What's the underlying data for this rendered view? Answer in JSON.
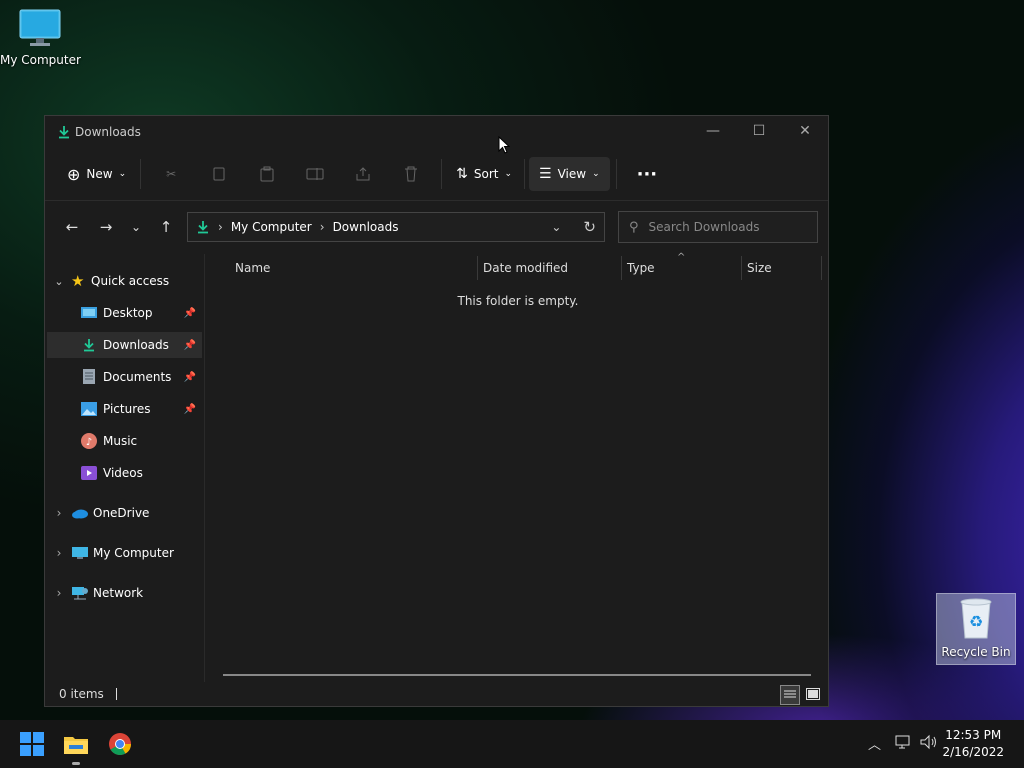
{
  "desktop": {
    "my_computer_label": "My Computer",
    "recycle_bin_label": "Recycle Bin"
  },
  "window": {
    "title": "Downloads",
    "toolbar": {
      "new_label": "New",
      "sort_label": "Sort",
      "view_label": "View"
    },
    "address": {
      "segments": [
        "My Computer",
        "Downloads"
      ]
    },
    "search": {
      "placeholder": "Search Downloads"
    },
    "nav": {
      "quick_access": "Quick access",
      "items": [
        {
          "label": "Desktop",
          "pinned": true
        },
        {
          "label": "Downloads",
          "pinned": true,
          "selected": true
        },
        {
          "label": "Documents",
          "pinned": true
        },
        {
          "label": "Pictures",
          "pinned": true
        },
        {
          "label": "Music",
          "pinned": false
        },
        {
          "label": "Videos",
          "pinned": false
        }
      ],
      "onedrive": "OneDrive",
      "my_computer": "My Computer",
      "network": "Network"
    },
    "columns": [
      "Name",
      "Date modified",
      "Type",
      "Size"
    ],
    "empty_message": "This folder is empty.",
    "status": "0 items"
  },
  "taskbar": {
    "time": "12:53 PM",
    "date": "2/16/2022"
  },
  "colors": {
    "accent": "#3aa0ff",
    "download_green": "#20c997",
    "window_bg": "#1c1c1c"
  }
}
